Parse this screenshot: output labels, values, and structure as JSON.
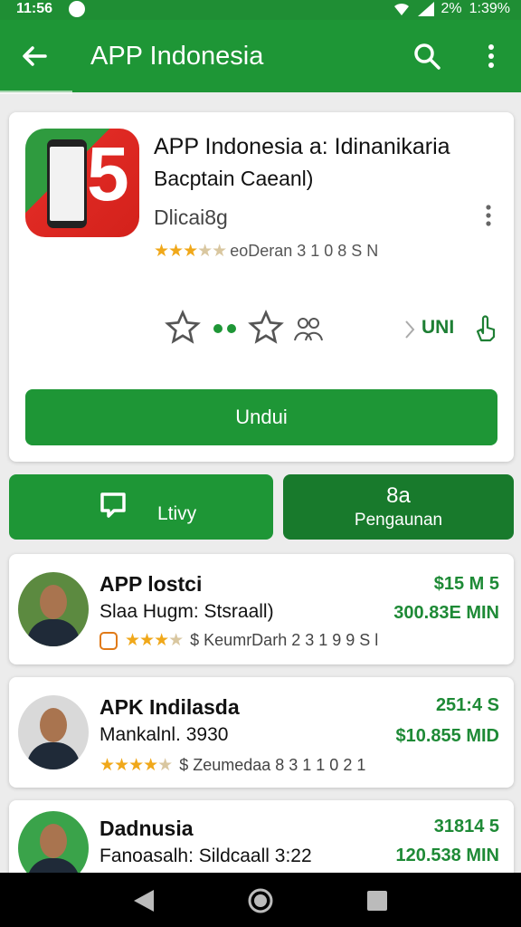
{
  "status_bar": {
    "time": "11:56",
    "battery": "2%",
    "clock_right": "1:39%"
  },
  "app_bar": {
    "title": "APP Indonesia"
  },
  "app_detail": {
    "title": "APP Indonesia a: Idinanikaria",
    "subtitle": "Bacptain Caeanl)",
    "developer": "Dlicai8g",
    "rating": 3.5,
    "rating_text": "eoDeran 3 1 0 8 S N",
    "action_label": "UNI",
    "install_label": "Undui"
  },
  "buttons": {
    "left_label": "Ltivy",
    "right_count": "8a",
    "right_label": "Pengaunan"
  },
  "list": [
    {
      "name": "APP lostci",
      "subtitle": "Slaa Hugm: Stsraall)",
      "rating": 3.5,
      "meta": "$ KeumrDarh 2 3 1 9 9 S l",
      "stat_top": "$15 M 5",
      "stat_bottom": "300.83E MIN",
      "avatar_bg": "#5c8a40"
    },
    {
      "name": "APK Indilasda",
      "subtitle": "Mankalnl. 3930",
      "rating": 4.5,
      "meta": "$ Zeumedaa 8 3 1 1 0 2 1",
      "stat_top": "251:4 S",
      "stat_bottom": "$10.855 MID",
      "avatar_bg": "#d9d9d9"
    },
    {
      "name": "Dadnusia",
      "subtitle": "Fanoasalh: Sildcaall 3:22",
      "stat_top": "31814 5",
      "stat_bottom": "120.538 MIN",
      "avatar_bg": "#3aa34a"
    }
  ],
  "colors": {
    "primary": "#1e9636",
    "primary_dark": "#187a2c",
    "star": "#f0a81a",
    "accent_text": "#1e8a36"
  }
}
